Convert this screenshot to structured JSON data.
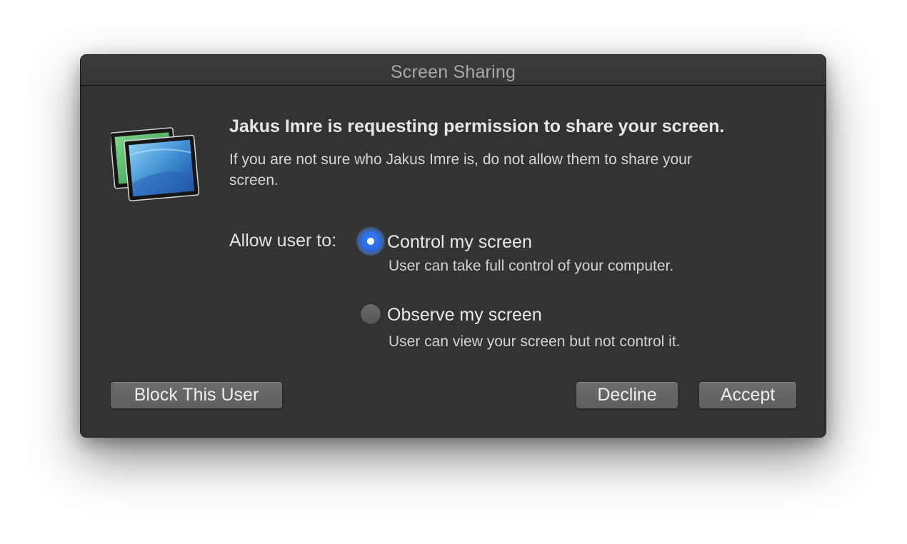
{
  "window": {
    "title": "Screen Sharing"
  },
  "icon": {
    "name": "screen-sharing-app-icon",
    "colors": {
      "front_screen": "#3a8fd6",
      "back_screen": "#4caf62",
      "frame": "#1a1a1a"
    }
  },
  "message": {
    "heading": "Jakus Imre is requesting permission to share your screen.",
    "body": "If you are not sure who Jakus Imre is, do not allow them to share your screen."
  },
  "permissions": {
    "label": "Allow user to:",
    "options": [
      {
        "label": "Control my screen",
        "description": "User can take full control of your computer.",
        "selected": true
      },
      {
        "label": "Observe my screen",
        "description": "User can view your screen but not control it.",
        "selected": false
      }
    ]
  },
  "buttons": {
    "block": "Block This User",
    "decline": "Decline",
    "accept": "Accept"
  },
  "colors": {
    "window_bg": "#333334",
    "accent": "#2a6ae0",
    "button_bg": "#656566"
  }
}
